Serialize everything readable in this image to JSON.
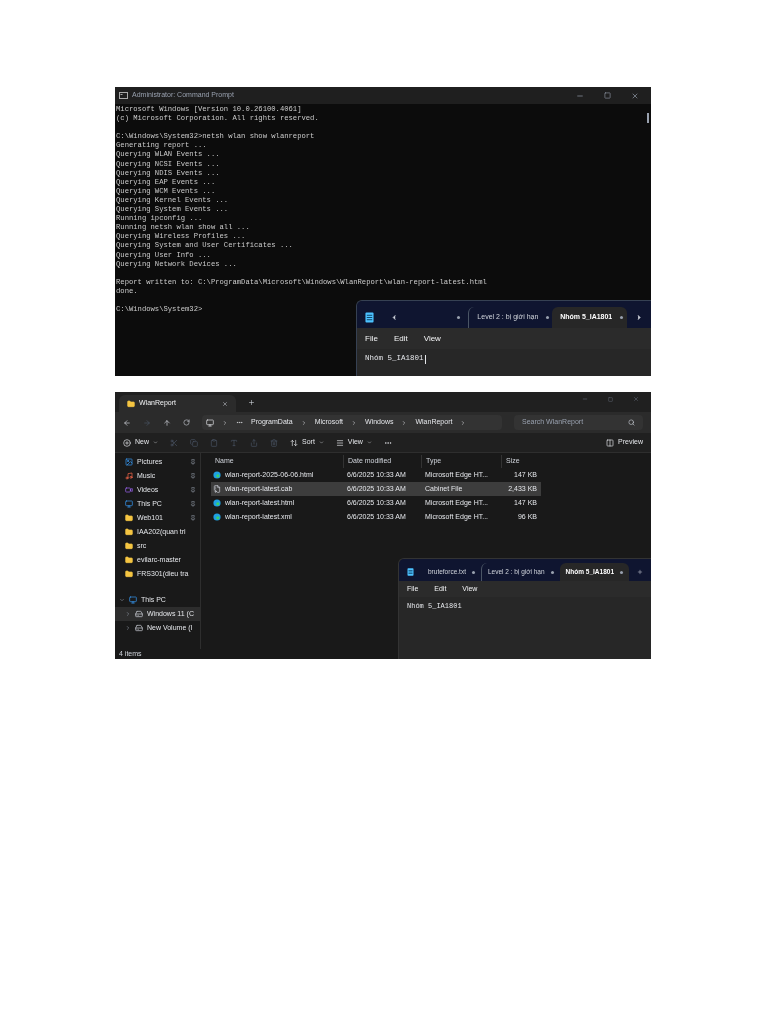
{
  "terminal": {
    "title": "Administrator: Command Prompt",
    "blocks": [
      [
        "Microsoft Windows [Version 10.0.26100.4061]",
        "(c) Microsoft Corporation. All rights reserved."
      ],
      [
        "C:\\Windows\\System32>netsh wlan show wlanreport",
        "Generating report ...",
        "Querying WLAN Events ...",
        "Querying NCSI Events ...",
        "Querying NDIS Events ...",
        "Querying EAP Events ...",
        "Querying WCM Events ...",
        "Querying Kernel Events ...",
        "Querying System Events ...",
        "Running ipconfig ...",
        "Running netsh wlan show all ...",
        "Querying Wireless Profiles ...",
        "Querying System and User Certificates ...",
        "Querying User Info ...",
        "Querying Network Devices ..."
      ],
      [
        "Report written to: C:\\ProgramData\\Microsoft\\Windows\\WlanReport\\wlan-report-latest.html",
        "done."
      ],
      [
        "C:\\Windows\\System32>"
      ]
    ],
    "notepad": {
      "tabs": [
        {
          "modified": true,
          "selected": false
        },
        {
          "label": "Level 2 : bị giới hạn",
          "modified": true,
          "selected": false
        },
        {
          "label": "Nhóm 5_IA1801",
          "modified": true,
          "selected": true
        }
      ],
      "menu": [
        "File",
        "Edit",
        "View"
      ],
      "content": "Nhóm 5_IA1801"
    }
  },
  "explorer": {
    "tab_title": "WlanReport",
    "breadcrumb": [
      "ProgramData",
      "Microsoft",
      "Windows",
      "WlanReport"
    ],
    "search": {
      "placeholder": "Search WlanReport"
    },
    "toolbar": {
      "new": "New",
      "sort": "Sort",
      "view": "View",
      "preview": "Preview"
    },
    "sidebar": [
      {
        "label": "Pictures",
        "kind": "pictures",
        "pinned": true,
        "selected": false
      },
      {
        "label": "Music",
        "kind": "music",
        "pinned": true,
        "selected": false
      },
      {
        "label": "Videos",
        "kind": "videos",
        "pinned": true,
        "selected": false
      },
      {
        "label": "This PC",
        "kind": "pc",
        "pinned": true,
        "selected": false
      },
      {
        "label": "Web101",
        "kind": "folder",
        "pinned": true,
        "selected": false
      },
      {
        "label": "IAA202(quan tri",
        "kind": "folder",
        "pinned": false,
        "selected": false
      },
      {
        "label": "src",
        "kind": "folder",
        "pinned": false,
        "selected": false
      },
      {
        "label": "evilarc-master",
        "kind": "folder",
        "pinned": false,
        "selected": false
      },
      {
        "label": "FRS301(dieu tra",
        "kind": "folder",
        "pinned": false,
        "selected": false
      }
    ],
    "tree": [
      {
        "label": "This PC",
        "kind": "pc",
        "expanded": true,
        "selected": false,
        "children": [
          {
            "label": "Windows 11 (C",
            "kind": "drive",
            "expanded": false,
            "selected": true
          },
          {
            "label": "New Volume (I",
            "kind": "drive",
            "expanded": false,
            "selected": false
          }
        ]
      }
    ],
    "columns": [
      "Name",
      "Date modified",
      "Type",
      "Size"
    ],
    "files": [
      {
        "kind": "edge",
        "name": "wlan-report-2025-06-06.html",
        "date": "6/6/2025 10:33 AM",
        "type": "Microsoft Edge HT...",
        "size": "147 KB",
        "selected": false
      },
      {
        "kind": "cab",
        "name": "wlan-report-latest.cab",
        "date": "6/6/2025 10:33 AM",
        "type": "Cabinet File",
        "size": "2,433 KB",
        "selected": true
      },
      {
        "kind": "edge",
        "name": "wlan-report-latest.html",
        "date": "6/6/2025 10:33 AM",
        "type": "Microsoft Edge HT...",
        "size": "147 KB",
        "selected": false
      },
      {
        "kind": "edge",
        "name": "wlan-report-latest.xml",
        "date": "6/6/2025 10:33 AM",
        "type": "Microsoft Edge HT...",
        "size": "96 KB",
        "selected": false
      }
    ],
    "status": "4 items",
    "notepad": {
      "tabs": [
        {
          "label": "bruteforce.txt",
          "modified": true,
          "selected": false
        },
        {
          "label": "Level 2 : bị giới hạn",
          "modified": true,
          "selected": false
        },
        {
          "label": "Nhóm 5_IA1801",
          "modified": true,
          "selected": true
        }
      ],
      "menu": [
        "File",
        "Edit",
        "View"
      ],
      "content": "Nhóm 5_IA1801"
    }
  }
}
